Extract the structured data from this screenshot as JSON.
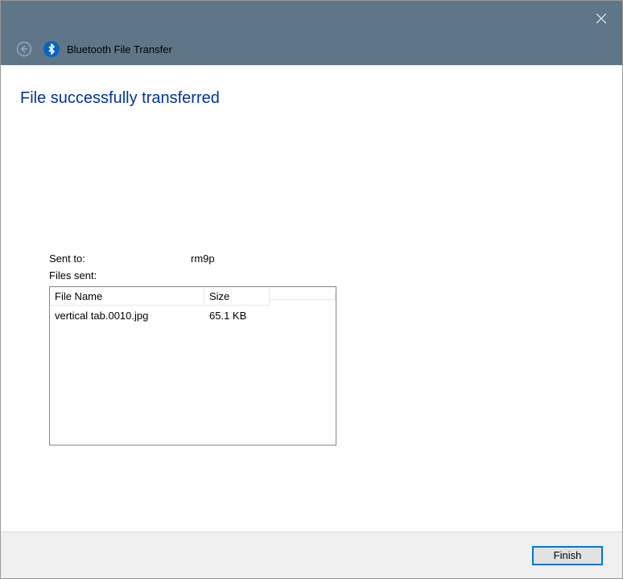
{
  "titlebar": {
    "title": "Bluetooth File Transfer"
  },
  "content": {
    "heading": "File successfully transferred",
    "sent_to_label": "Sent to:",
    "sent_to_value": "rm9p",
    "files_sent_label": "Files sent:",
    "table": {
      "header_name": "File Name",
      "header_size": "Size",
      "rows": [
        {
          "name": "vertical tab.0010.jpg",
          "size": "65.1 KB"
        }
      ]
    }
  },
  "footer": {
    "finish_label": "Finish"
  }
}
